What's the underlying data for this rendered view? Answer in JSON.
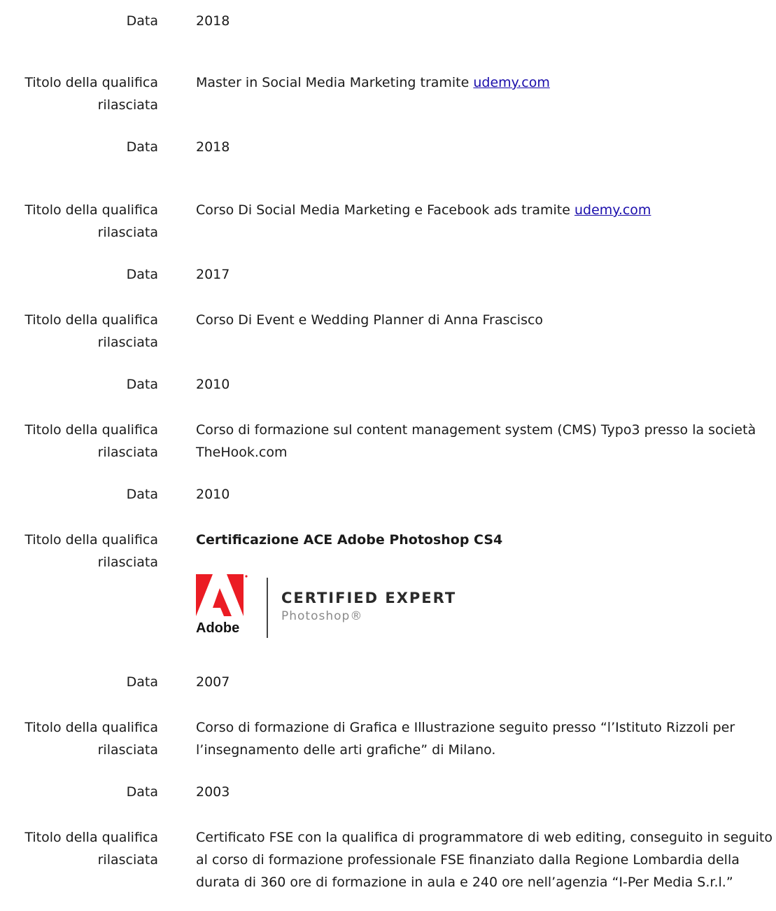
{
  "entries": [
    {
      "label": "Data",
      "value": "2018"
    },
    {
      "label": "Titolo della qualifica rilasciata",
      "value": "Master in Social Media Marketing tramite ",
      "link": "udemy.com"
    },
    {
      "label": "Data",
      "value": "2018"
    },
    {
      "label": "Titolo della qualifica rilasciata",
      "value": "Corso Di Social Media Marketing e Facebook ads tramite ",
      "link": "udemy.com"
    },
    {
      "label": "Data",
      "value": "2017"
    },
    {
      "label": "Titolo della qualifica rilasciata",
      "value": "Corso Di Event e Wedding Planner di Anna Frascisco"
    },
    {
      "label": "Data",
      "value": "2010"
    },
    {
      "label": "Titolo della qualifica rilasciata",
      "value": "Corso di formazione sul content management system (CMS) Typo3 presso la società TheHook.com"
    },
    {
      "label": "Data",
      "value": "2010"
    },
    {
      "label": "Titolo della qualifica rilasciata",
      "value": "Certificazione ACE Adobe Photoshop CS4"
    },
    {
      "label": "Data",
      "value": "2007"
    },
    {
      "label": "Titolo della qualifica rilasciata",
      "value": "Corso di formazione di Grafica e Illustrazione seguito presso “l’Istituto Rizzoli per l’insegnamento delle arti grafiche” di Milano."
    },
    {
      "label": "Data",
      "value": "2003"
    },
    {
      "label": "Titolo della qualifica rilasciata",
      "value": "Certificato FSE con la qualifica di programmatore di web editing, conseguito in seguito al corso di formazione professionale FSE finanziato dalla Regione Lombardia della durata di 360 ore di formazione in aula e 240 ore nell’agenzia “I-Per Media S.r.l.”"
    }
  ],
  "badge": {
    "brand": "Adobe",
    "title": "CERTIFIED EXPERT",
    "subtitle": "Photoshop®",
    "brand_color": "#eb1c24"
  }
}
